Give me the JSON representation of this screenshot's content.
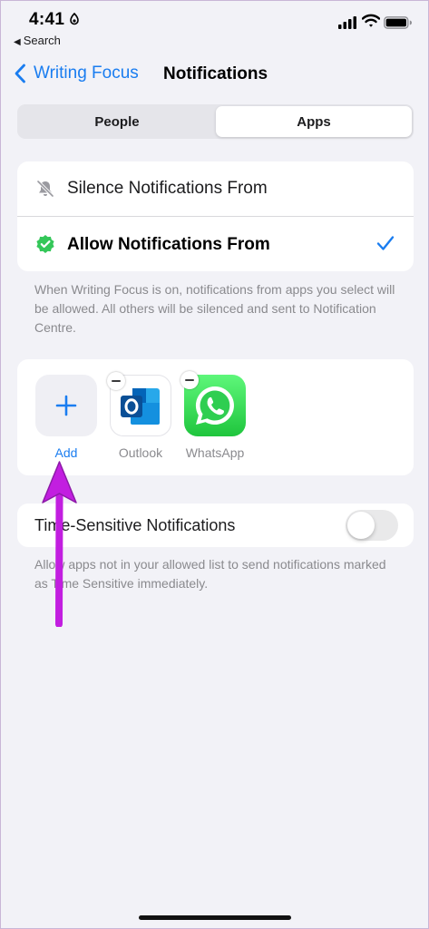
{
  "status_bar": {
    "time": "4:41",
    "back_app": "Search"
  },
  "nav": {
    "back_label": "Writing Focus",
    "title": "Notifications"
  },
  "segmented_control": {
    "options": [
      "People",
      "Apps"
    ],
    "selected": "Apps"
  },
  "mode_options": {
    "silence_label": "Silence Notifications From",
    "allow_label": "Allow Notifications From",
    "selected": "Allow Notifications From"
  },
  "mode_footnote": "When Writing Focus is on, notifications from apps you select will be allowed. All others will be silenced and sent to Notification Centre.",
  "allowed_apps": {
    "add_label": "Add",
    "apps": [
      {
        "name": "Outlook",
        "icon": "outlook-app-icon"
      },
      {
        "name": "WhatsApp",
        "icon": "whatsapp-app-icon"
      }
    ]
  },
  "time_sensitive": {
    "label": "Time-Sensitive Notifications",
    "enabled": false,
    "footnote": "Allow apps not in your allowed list to send notifications marked as Time Sensitive immediately."
  },
  "colors": {
    "accent": "#1a7df0",
    "annotation_arrow": "#c21ee0",
    "allow_badge": "#34c759"
  }
}
